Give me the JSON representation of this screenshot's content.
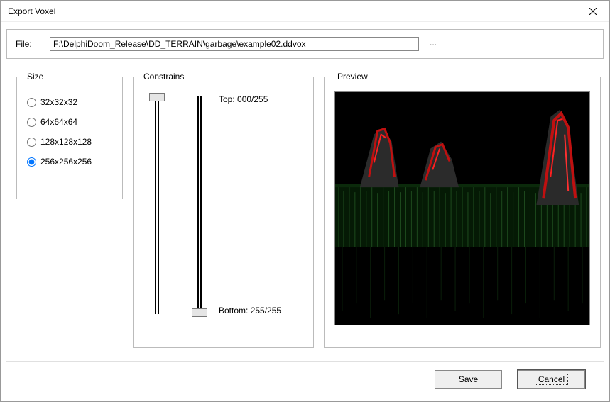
{
  "window": {
    "title": "Export Voxel"
  },
  "file": {
    "label": "File:",
    "value": "F:\\DelphiDoom_Release\\DD_TERRAIN\\garbage\\example02.ddvox",
    "browse": "..."
  },
  "size": {
    "legend": "Size",
    "options": [
      {
        "label": "32x32x32",
        "checked": false
      },
      {
        "label": "64x64x64",
        "checked": false
      },
      {
        "label": "128x128x128",
        "checked": false
      },
      {
        "label": "256x256x256",
        "checked": true
      }
    ]
  },
  "constrains": {
    "legend": "Constrains",
    "top_label": "Top: 000/255",
    "bottom_label": "Bottom: 255/255",
    "slider_top_value": 0,
    "slider_top_max": 255,
    "slider_bottom_value": 255,
    "slider_bottom_max": 255
  },
  "preview": {
    "legend": "Preview"
  },
  "buttons": {
    "save": "Save",
    "cancel": "Cancel"
  }
}
